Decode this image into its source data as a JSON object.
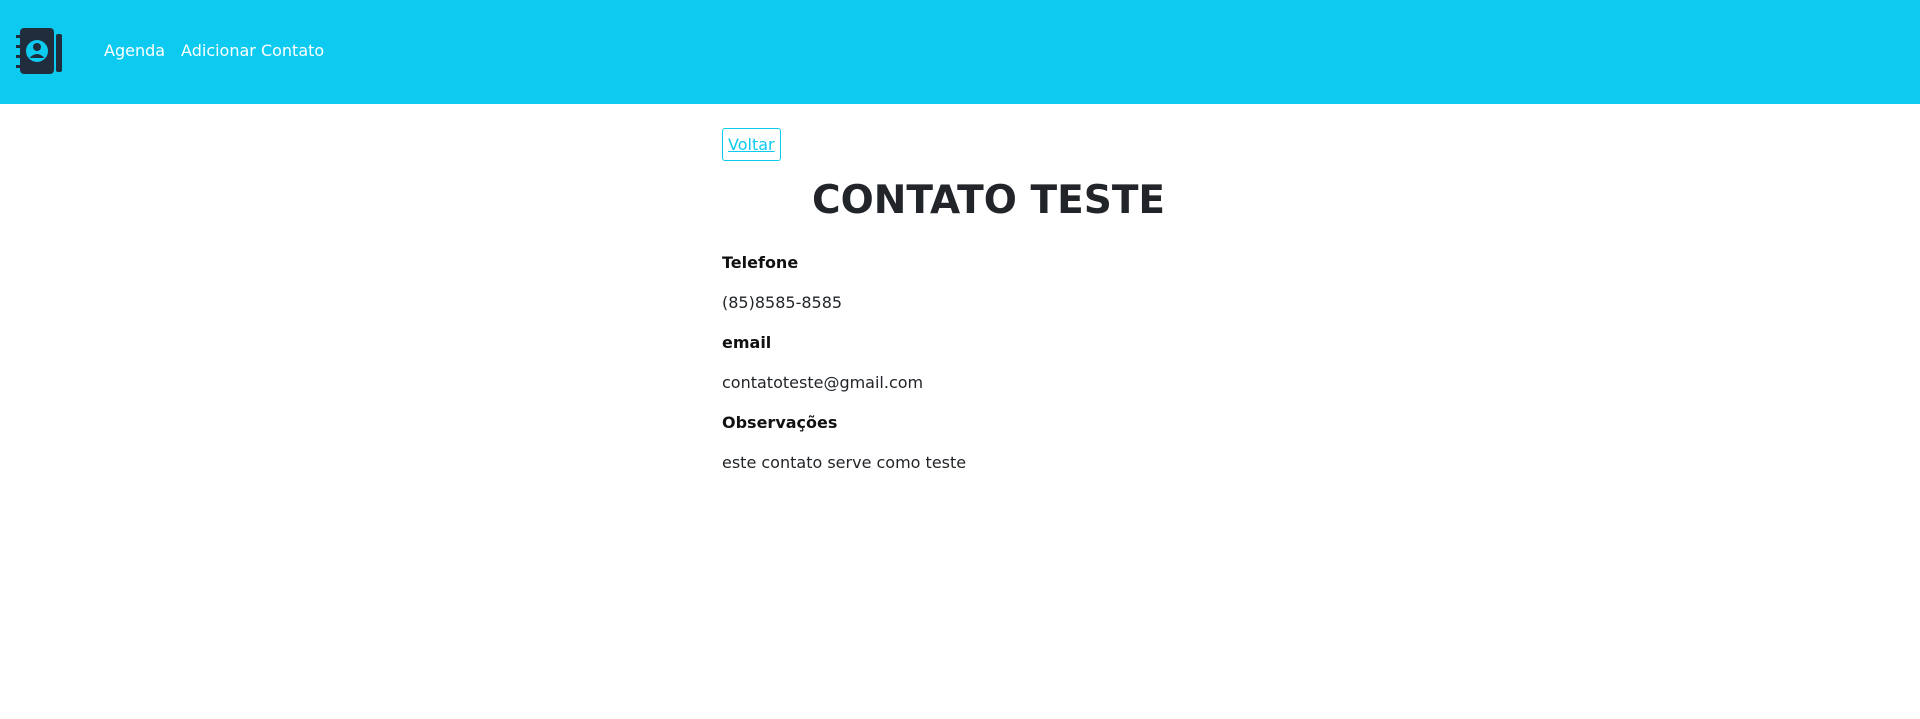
{
  "navbar": {
    "logo_icon": "contact-book-icon",
    "background": "#0dcaf0",
    "links": [
      "Agenda",
      "Adicionar Contato"
    ]
  },
  "main": {
    "back_label": "Voltar",
    "title": "CONTATO TESTE",
    "fields": [
      {
        "label": "Telefone",
        "value": "(85)8585-8585"
      },
      {
        "label": "email",
        "value": "contatoteste@gmail.com"
      },
      {
        "label": "Observações",
        "value": "este contato serve como teste"
      }
    ]
  }
}
